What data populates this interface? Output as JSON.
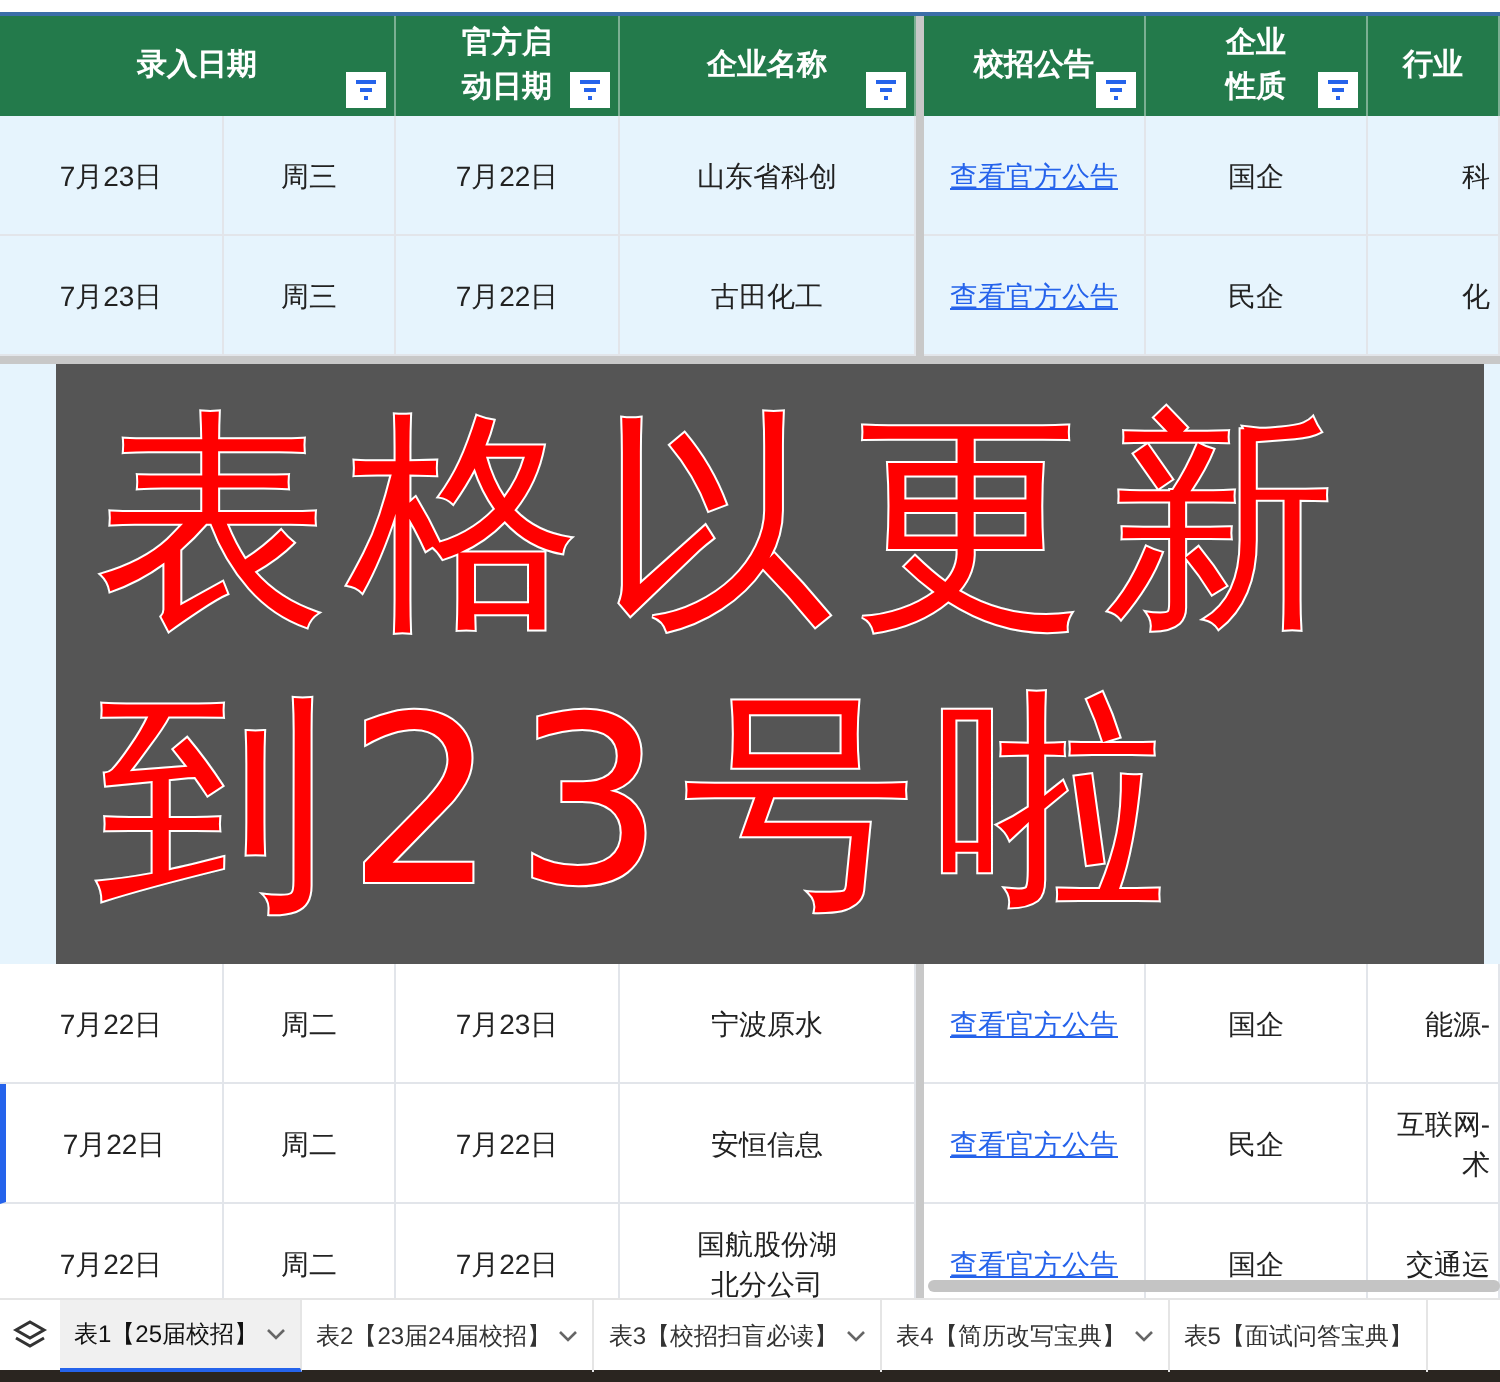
{
  "columns": [
    {
      "label": "录入日期",
      "filter": true
    },
    {
      "label": "官方启动日期",
      "filter": true
    },
    {
      "label": "企业名称",
      "filter": true
    },
    {
      "label": "校招公告",
      "filter": true
    },
    {
      "label": "企业性质",
      "filter": true
    },
    {
      "label": "行业",
      "filter": false
    }
  ],
  "rows_top": [
    {
      "entry_date": "7月23日",
      "weekday": "周三",
      "start_date": "7月22日",
      "company": "山东省科创",
      "notice": "查看官方公告",
      "nature": "国企",
      "industry": "科",
      "highlighted": true,
      "selected": false
    },
    {
      "entry_date": "7月23日",
      "weekday": "周三",
      "start_date": "7月22日",
      "company": "古田化工",
      "notice": "查看官方公告",
      "nature": "民企",
      "industry": "化",
      "highlighted": true,
      "selected": false
    }
  ],
  "overlay": {
    "lines": [
      "表格以更新",
      "到23号啦"
    ]
  },
  "rows_bottom": [
    {
      "entry_date": "7月22日",
      "weekday": "周二",
      "start_date": "7月23日",
      "company": "宁波原水",
      "notice": "查看官方公告",
      "nature": "国企",
      "industry": "能源-",
      "highlighted": false,
      "selected": false
    },
    {
      "entry_date": "7月22日",
      "weekday": "周二",
      "start_date": "7月22日",
      "company": "安恒信息",
      "notice": "查看官方公告",
      "nature": "民企",
      "industry": "互联网-术",
      "highlighted": false,
      "selected": true
    },
    {
      "entry_date": "7月22日",
      "weekday": "周二",
      "start_date": "7月22日",
      "company": "国航股份湖北分公司",
      "notice": "查看官方公告",
      "nature": "国企",
      "industry": "交通运",
      "highlighted": false,
      "selected": false
    }
  ],
  "sheet_tabs": [
    {
      "label": "表1【25届校招】",
      "selected": true
    },
    {
      "label": "表2【23届24届校招】",
      "selected": false
    },
    {
      "label": "表3【校招扫盲必读】",
      "selected": false
    },
    {
      "label": "表4【简历改写宝典】",
      "selected": false
    },
    {
      "label": "表5【面试问答宝典】",
      "selected": false
    }
  ]
}
